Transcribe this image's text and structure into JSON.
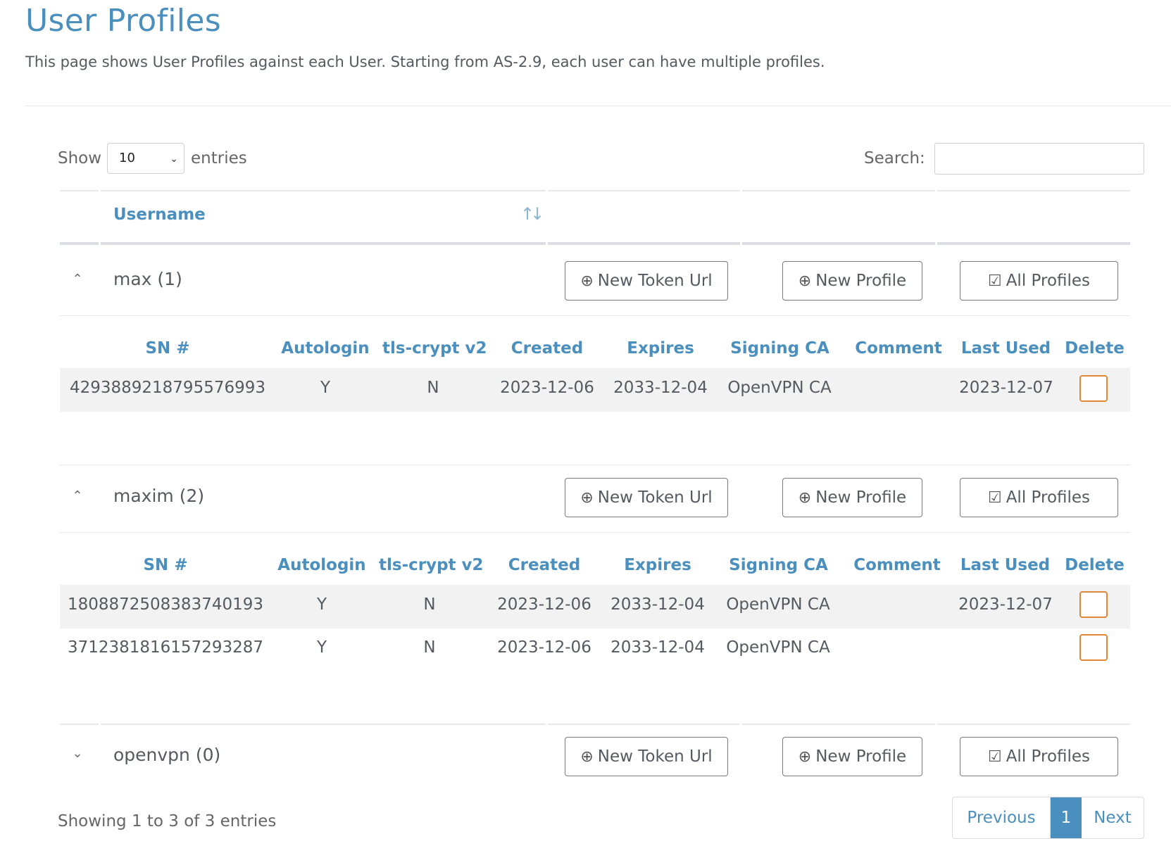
{
  "page": {
    "title": "User Profiles",
    "description": "This page shows User Profiles against each User. Starting from AS-2.9, each user can have multiple profiles."
  },
  "controls": {
    "show_label": "Show",
    "page_size": "10",
    "entries_label": "entries",
    "search_label": "Search:",
    "search_value": ""
  },
  "table": {
    "username_header": "Username",
    "sub_headers": [
      "SN #",
      "Autologin",
      "tls-crypt v2",
      "Created",
      "Expires",
      "Signing CA",
      "Comment",
      "Last Used",
      "Delete"
    ],
    "buttons": {
      "new_token_url": "New Token Url",
      "new_profile": "New Profile",
      "all_profiles": "All Profiles"
    },
    "groups": [
      {
        "name": "max (1)",
        "expanded": true,
        "profiles": [
          {
            "sn": "4293889218795576993",
            "autologin": "Y",
            "tls_crypt": "N",
            "created": "2023-12-06",
            "expires": "2033-12-04",
            "signing_ca": "OpenVPN CA",
            "comment": "",
            "last_used": "2023-12-07"
          }
        ]
      },
      {
        "name": "maxim (2)",
        "expanded": true,
        "profiles": [
          {
            "sn": "1808872508383740193",
            "autologin": "Y",
            "tls_crypt": "N",
            "created": "2023-12-06",
            "expires": "2033-12-04",
            "signing_ca": "OpenVPN CA",
            "comment": "",
            "last_used": "2023-12-07"
          },
          {
            "sn": "3712381816157293287",
            "autologin": "Y",
            "tls_crypt": "N",
            "created": "2023-12-06",
            "expires": "2033-12-04",
            "signing_ca": "OpenVPN CA",
            "comment": "",
            "last_used": ""
          }
        ]
      },
      {
        "name": "openvpn (0)",
        "expanded": false,
        "profiles": []
      }
    ]
  },
  "footer": {
    "info": "Showing 1 to 3 of 3 entries",
    "previous": "Previous",
    "current_page": "1",
    "next": "Next"
  },
  "colors": {
    "accent": "#4a8fbd",
    "delete_border": "#e0883a"
  },
  "icons": {
    "caret_up": "caret-up-icon",
    "caret_down": "caret-down-icon",
    "plus_circle": "plus-circle-icon",
    "checkbox": "check-square-icon",
    "sort": "sort-icon"
  }
}
